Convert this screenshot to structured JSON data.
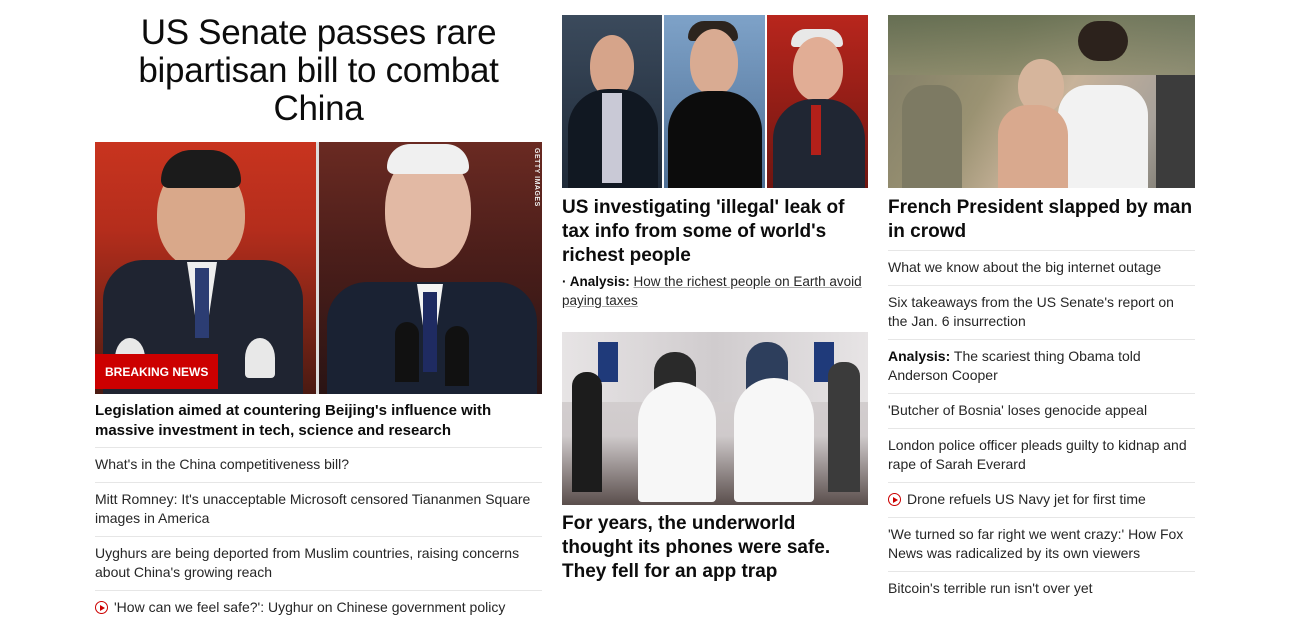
{
  "lead": {
    "headline": "US Senate passes rare bipartisan bill to combat China",
    "image_credit": "GETTY IMAGES",
    "badge": "BREAKING NEWS",
    "story": "Legislation aimed at countering Beijing's influence with massive investment in tech, science and research",
    "related": [
      {
        "text": "What's in the China competitiveness bill?",
        "video": false
      },
      {
        "text": "Mitt Romney: It's unacceptable Microsoft censored Tiananmen Square images in America",
        "video": false
      },
      {
        "text": "Uyghurs are being deported from Muslim countries, raising concerns about China's growing reach",
        "video": false
      },
      {
        "text": "'How can we feel safe?': Uyghur on Chinese government policy",
        "video": true
      }
    ]
  },
  "middle": {
    "story1": {
      "headline": "US investigating 'illegal' leak of tax info from some of world's richest people",
      "analysis_label": "Analysis:",
      "analysis_text": "How the richest people on Earth avoid paying taxes"
    },
    "story2": {
      "headline": "For years, the underworld thought its phones were safe. They fell for an app trap"
    }
  },
  "right": {
    "headline": "French President slapped by man in crowd",
    "items": [
      {
        "label": "",
        "text": "What we know about the big internet outage",
        "video": false
      },
      {
        "label": "",
        "text": "Six takeaways from the US Senate's report on the Jan. 6 insurrection",
        "video": false
      },
      {
        "label": "Analysis:",
        "text": "The scariest thing Obama told Anderson Cooper",
        "video": false
      },
      {
        "label": "",
        "text": "'Butcher of Bosnia' loses genocide appeal",
        "video": false
      },
      {
        "label": "",
        "text": "London police officer pleads guilty to kidnap and rape of Sarah Everard",
        "video": false
      },
      {
        "label": "",
        "text": "Drone refuels US Navy jet for first time",
        "video": true
      },
      {
        "label": "",
        "text": "'We turned so far right we went crazy:' How Fox News was radicalized by its own viewers",
        "video": false
      },
      {
        "label": "",
        "text": "Bitcoin's terrible run isn't over yet",
        "video": false
      }
    ]
  },
  "colors": {
    "accent": "#cc0000",
    "text": "#262626",
    "headline": "#0c0c0c",
    "divider": "#e6e6e6"
  }
}
